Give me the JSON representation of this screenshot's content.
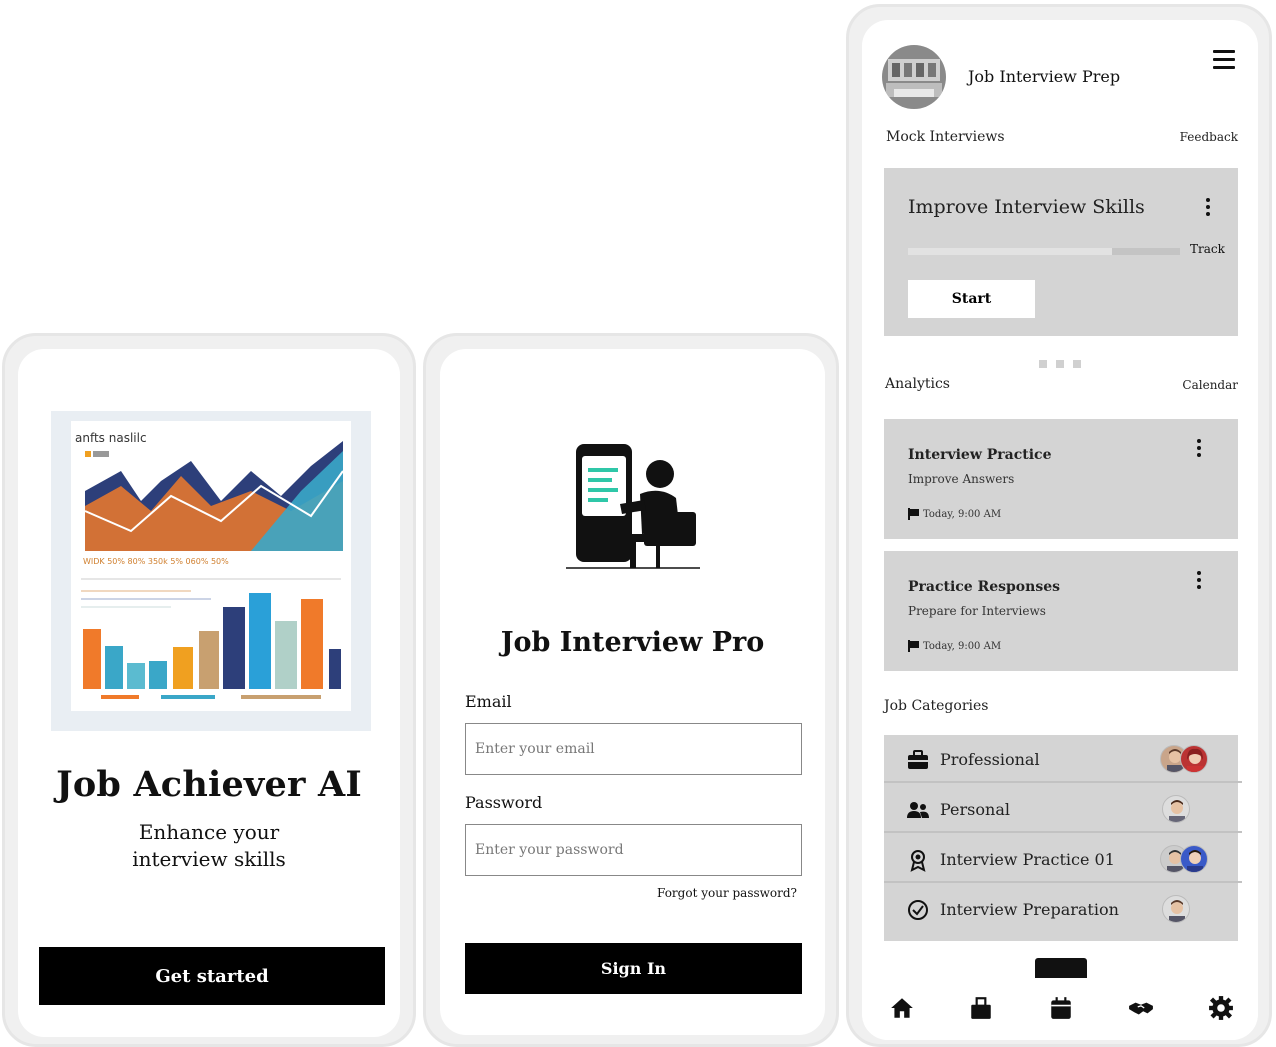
{
  "welcome": {
    "title": "Job Achiever AI",
    "subtitle": "Enhance your interview skills",
    "cta_label": "Get started",
    "hero_image_text": "anfts naslilc"
  },
  "signin": {
    "title": "Job Interview Pro",
    "email_label": "Email",
    "email_placeholder": "Enter your email",
    "password_label": "Password",
    "password_placeholder": "Enter your password",
    "forgot_label": "Forgot your password?",
    "submit_label": "Sign In"
  },
  "dashboard": {
    "app_title": "Job Interview Prep",
    "mock_section": "Mock Interviews",
    "mock_link": "Feedback",
    "hero_card": {
      "title": "Improve Interview Skills",
      "track_label": "Track",
      "start_label": "Start",
      "progress": 0.75
    },
    "analytics_section": "Analytics",
    "analytics_link": "Calendar",
    "items": [
      {
        "title": "Interview Practice",
        "subtitle": "Improve Answers",
        "time": "Today, 9:00 AM"
      },
      {
        "title": "Practice Responses",
        "subtitle": "Prepare for Interviews",
        "time": "Today, 9:00 AM"
      }
    ],
    "categories_section": "Job Categories",
    "categories": [
      {
        "label": "Professional",
        "icon": "briefcase-icon"
      },
      {
        "label": "Personal",
        "icon": "people-icon"
      },
      {
        "label": "Interview Practice 01",
        "icon": "award-icon"
      },
      {
        "label": "Interview Preparation",
        "icon": "check-circle-icon"
      }
    ],
    "nav": [
      "home-icon",
      "jobs-icon",
      "calendar-icon",
      "handshake-icon",
      "settings-icon"
    ]
  }
}
